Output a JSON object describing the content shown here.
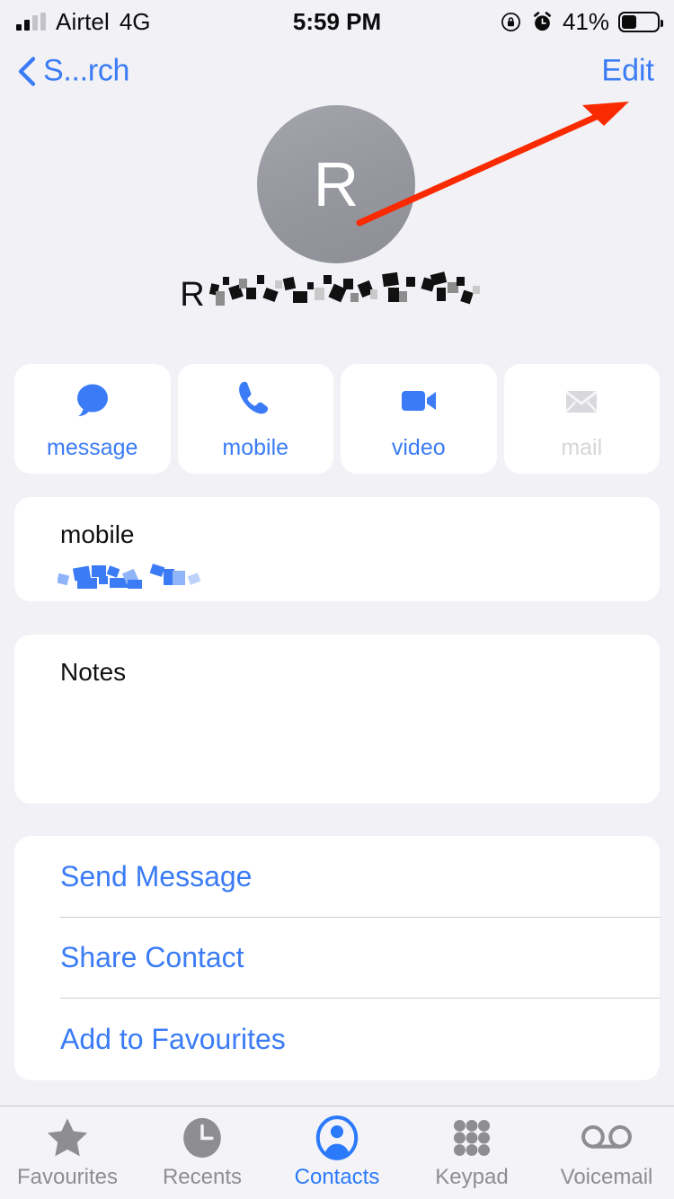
{
  "status_bar": {
    "carrier": "Airtel",
    "network": "4G",
    "time": "5:59 PM",
    "battery_percent": "41%",
    "battery_level": 41,
    "icons": [
      "signal-bars-icon",
      "rotation-lock-icon",
      "alarm-clock-icon",
      "battery-icon"
    ]
  },
  "nav_bar": {
    "back_label": "S...rch",
    "edit_label": "Edit"
  },
  "contact": {
    "avatar_initial": "R",
    "avatar_color": "#95969e",
    "name_visible_prefix": "R",
    "name_redacted": true
  },
  "quick_actions": [
    {
      "label": "message",
      "icon": "message-bubble-icon",
      "enabled": true
    },
    {
      "label": "mobile",
      "icon": "phone-handset-icon",
      "enabled": true
    },
    {
      "label": "video",
      "icon": "video-camera-icon",
      "enabled": true
    },
    {
      "label": "mail",
      "icon": "envelope-icon",
      "enabled": false
    }
  ],
  "phone_field": {
    "label": "mobile",
    "value_redacted": true
  },
  "notes_field": {
    "label": "Notes",
    "value": ""
  },
  "actions": [
    {
      "label": "Send Message"
    },
    {
      "label": "Share Contact"
    },
    {
      "label": "Add to Favourites"
    }
  ],
  "tab_bar": {
    "active": "Contacts",
    "items": [
      {
        "label": "Favourites",
        "icon": "star-icon",
        "active": false
      },
      {
        "label": "Recents",
        "icon": "clock-icon",
        "active": false
      },
      {
        "label": "Contacts",
        "icon": "person-circle-icon",
        "active": true
      },
      {
        "label": "Keypad",
        "icon": "keypad-dots-icon",
        "active": false
      },
      {
        "label": "Voicemail",
        "icon": "voicemail-tape-icon",
        "active": false
      }
    ]
  },
  "annotation": {
    "type": "arrow",
    "color": "#fa2a00",
    "points_to": "Edit"
  },
  "colors": {
    "accent_blue": "#3b7cf6",
    "tab_active_blue": "#2b7afc",
    "background": "#f1f1f6",
    "card": "#ffffff",
    "disabled_gray": "#d6d6da",
    "annotation_red": "#fa2a00"
  }
}
